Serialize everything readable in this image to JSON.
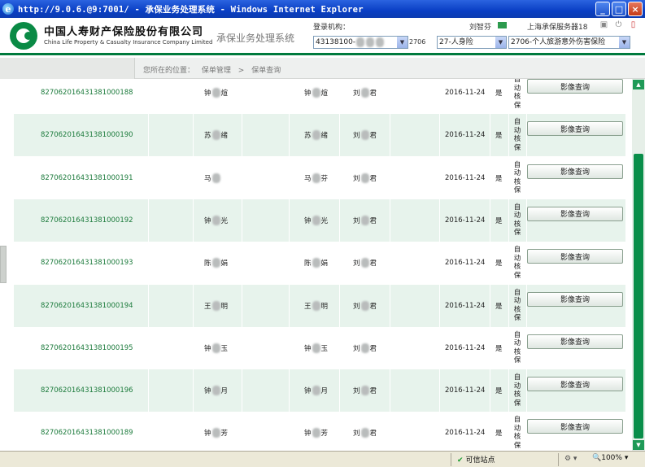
{
  "window": {
    "title": "http://9.0.6.@9:7001/ - 承保业务处理系统 - Windows Internet Explorer",
    "minimize": "_",
    "maximize": "□",
    "close": "×"
  },
  "header": {
    "company_cn": "中国人寿财产保险股份有限公司",
    "company_en": "China Life Property & Casualty Insurance Company Limited",
    "system_name": "承保业务处理系统",
    "login_label": "登录机构：",
    "org_value": "43138100-",
    "org_suffix": "2706",
    "select_category": "27-人身险",
    "select_product": "2706-个人旅游意外伤害保险",
    "user_name": "刘智芬",
    "server_name": "上海承保服务器18"
  },
  "breadcrumb": {
    "label": "您所在的位置：",
    "level1": "保单管理",
    "separator": ">",
    "level2": "保单查询"
  },
  "table": {
    "button_label": "影像查询",
    "audit_chars": [
      "自",
      "动",
      "核",
      "保"
    ],
    "rows": [
      {
        "policy": "827062016431381000188",
        "name1_a": "钟",
        "name1_b": "煊",
        "name2_a": "钟",
        "name2_b": "煊",
        "name3_a": "刘",
        "name3_b": "君",
        "date": "2016-11-24",
        "flag": "是"
      },
      {
        "policy": "827062016431381000190",
        "name1_a": "苏",
        "name1_b": "绪",
        "name2_a": "苏",
        "name2_b": "绪",
        "name3_a": "刘",
        "name3_b": "君",
        "date": "2016-11-24",
        "flag": "是"
      },
      {
        "policy": "827062016431381000191",
        "name1_a": "马",
        "name1_b": "",
        "name2_a": "马",
        "name2_b": "芬",
        "name3_a": "刘",
        "name3_b": "君",
        "date": "2016-11-24",
        "flag": "是"
      },
      {
        "policy": "827062016431381000192",
        "name1_a": "钟",
        "name1_b": "光",
        "name2_a": "钟",
        "name2_b": "光",
        "name3_a": "刘",
        "name3_b": "君",
        "date": "2016-11-24",
        "flag": "是"
      },
      {
        "policy": "827062016431381000193",
        "name1_a": "陈",
        "name1_b": "娟",
        "name2_a": "陈",
        "name2_b": "娟",
        "name3_a": "刘",
        "name3_b": "君",
        "date": "2016-11-24",
        "flag": "是"
      },
      {
        "policy": "827062016431381000194",
        "name1_a": "王",
        "name1_b": "明",
        "name2_a": "王",
        "name2_b": "明",
        "name3_a": "刘",
        "name3_b": "君",
        "date": "2016-11-24",
        "flag": "是"
      },
      {
        "policy": "827062016431381000195",
        "name1_a": "钟",
        "name1_b": "玉",
        "name2_a": "钟",
        "name2_b": "玉",
        "name3_a": "刘",
        "name3_b": "君",
        "date": "2016-11-24",
        "flag": "是"
      },
      {
        "policy": "827062016431381000196",
        "name1_a": "钟",
        "name1_b": "月",
        "name2_a": "钟",
        "name2_b": "月",
        "name3_a": "刘",
        "name3_b": "君",
        "date": "2016-11-24",
        "flag": "是"
      },
      {
        "policy": "827062016431381000189",
        "name1_a": "钟",
        "name1_b": "芳",
        "name2_a": "钟",
        "name2_b": "芳",
        "name3_a": "刘",
        "name3_b": "君",
        "date": "2016-11-24",
        "flag": "是"
      }
    ]
  },
  "statusbar": {
    "trusted_zone": "可信站点",
    "zoom": "100%"
  },
  "colors": {
    "brand_green": "#007a3d",
    "row_alt": "#e7f3ec",
    "link_green": "#1b7a3b",
    "title_blue": "#0a3fc4"
  }
}
